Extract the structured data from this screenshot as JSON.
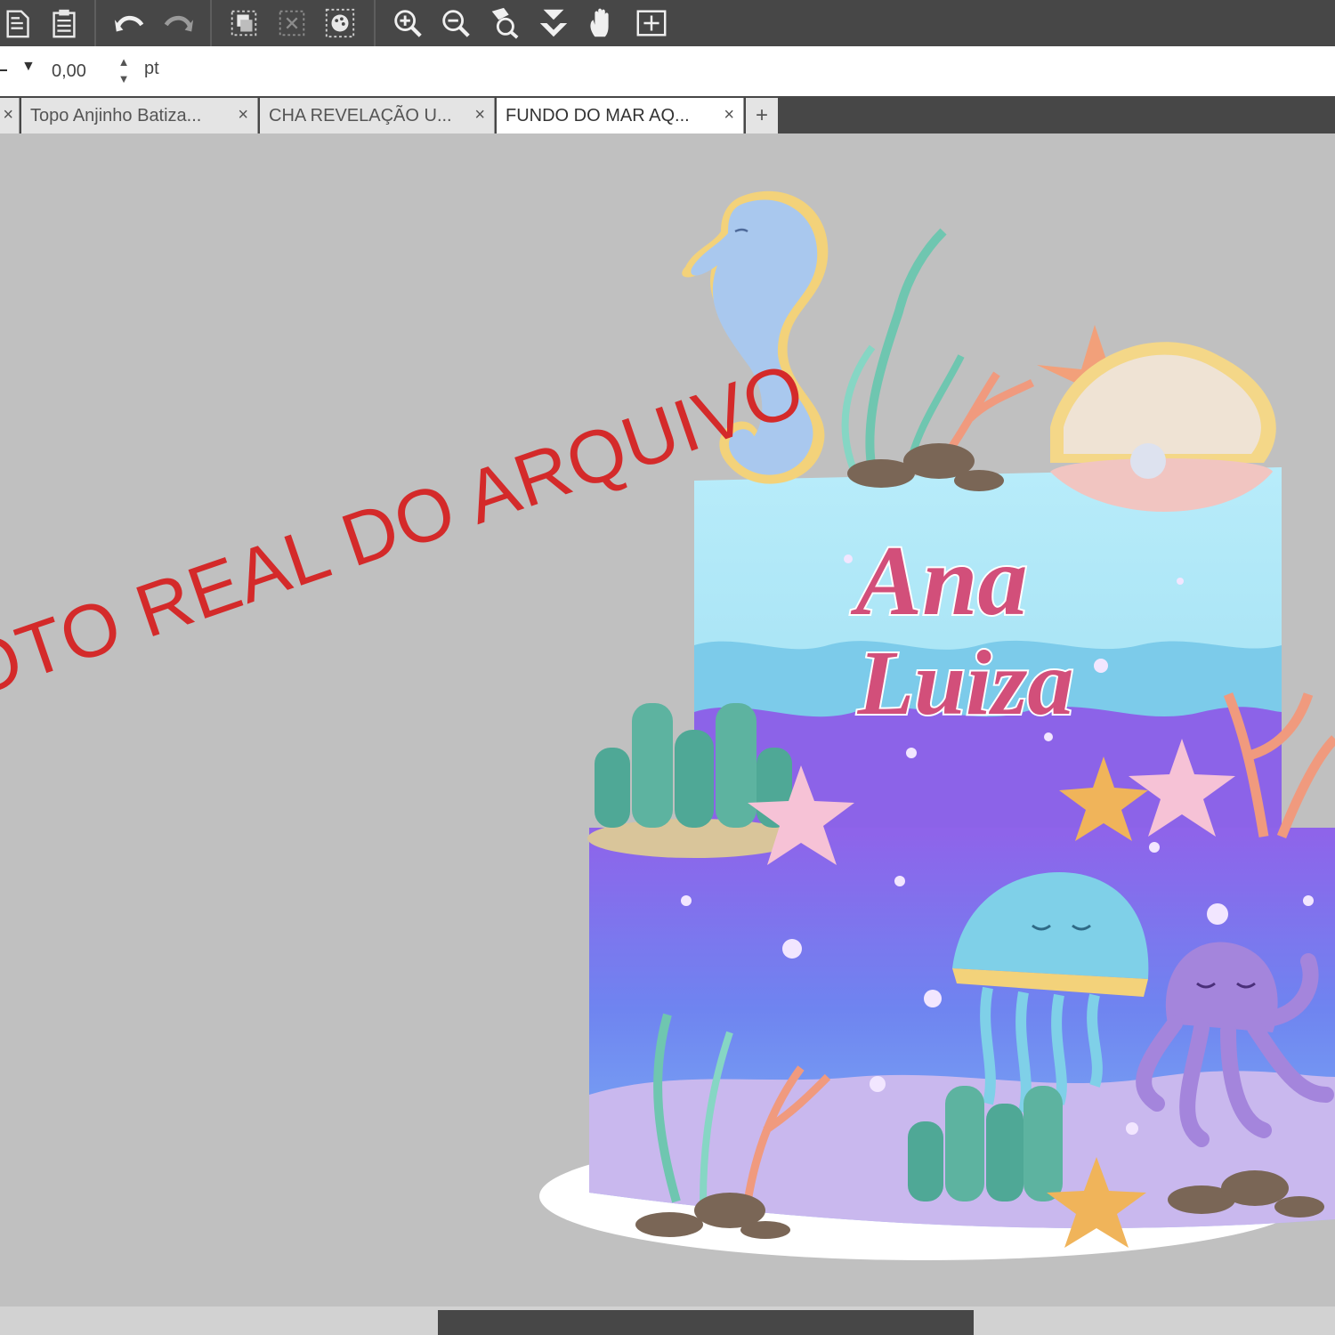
{
  "toolbar": {
    "icons": [
      "paste-icon",
      "clipboard-icon",
      "undo-icon",
      "redo-icon",
      "group-icon",
      "ungroup-icon",
      "palette-icon",
      "zoom-in-icon",
      "zoom-out-icon",
      "zoom-page-icon",
      "download-icon",
      "hand-icon",
      "fit-frame-icon"
    ]
  },
  "propbar": {
    "dropdown_arrow": "▼",
    "value": "0,00",
    "unit": "pt"
  },
  "tabs": {
    "items": [
      {
        "label": "",
        "close": "×"
      },
      {
        "label": "Topo Anjinho Batiza...",
        "close": "×"
      },
      {
        "label": "CHA REVELAÇÃO U...",
        "close": "×"
      },
      {
        "label": "FUNDO DO MAR AQ...",
        "close": "×"
      }
    ],
    "add": "+"
  },
  "canvas": {
    "watermark": "OTO REAL DO ARQUIVO",
    "cake_name_line1": "Ana",
    "cake_name_line2": "Luiza",
    "colors": {
      "tier_top": "#aee6f6",
      "tier_bottom_top": "#8a6ee8",
      "tier_bottom_mid": "#6f8ff2",
      "sand": "#c4b4ec",
      "name": "#d24f7a"
    }
  }
}
